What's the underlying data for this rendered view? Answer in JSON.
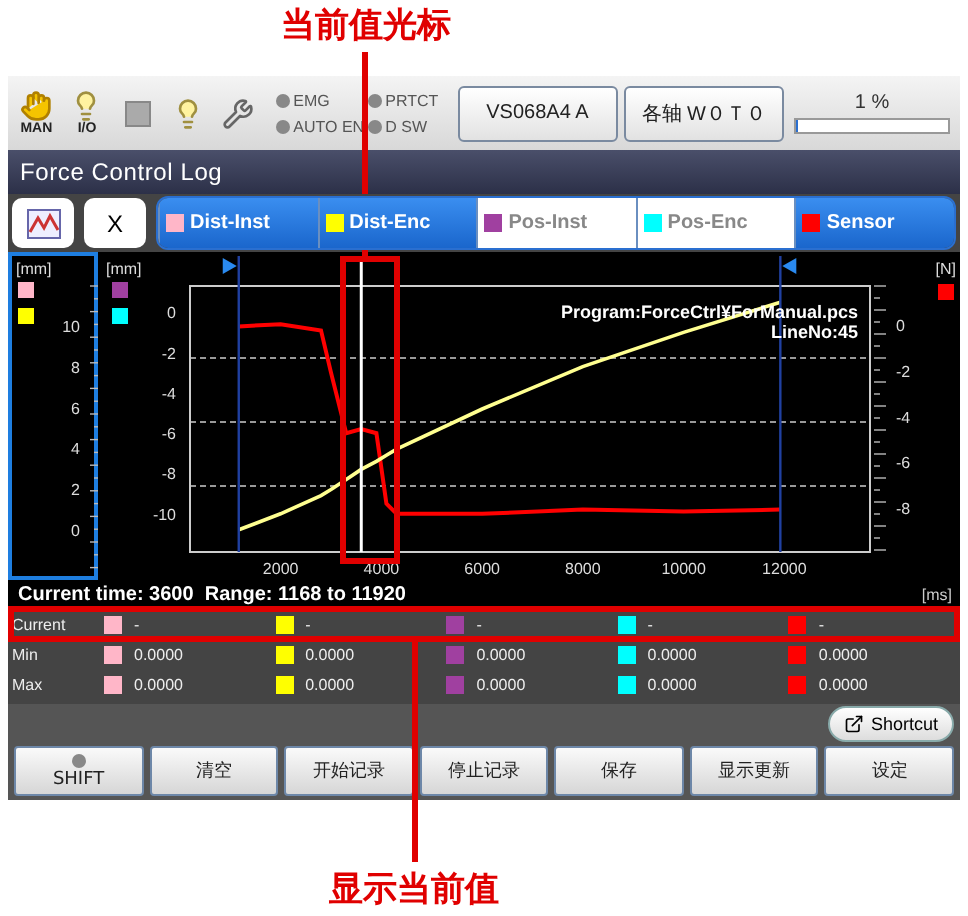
{
  "annotations": {
    "top": "当前值光标",
    "bottom": "显示当前值"
  },
  "status_bar": {
    "icons": [
      {
        "kind": "hand",
        "label": "MAN"
      },
      {
        "kind": "bulb",
        "label": "I/O"
      },
      {
        "kind": "square"
      },
      {
        "kind": "bulb"
      },
      {
        "kind": "wrench"
      }
    ],
    "indicators": [
      {
        "label": "EMG",
        "on": false
      },
      {
        "label": "AUTO EN",
        "on": false
      },
      {
        "label": "PRTCT",
        "on": false
      },
      {
        "label": "D SW",
        "on": false
      }
    ],
    "buttons": [
      "VS068A4 A",
      "各轴 W０Ｔ０"
    ],
    "speed": {
      "reading": "1 %",
      "level": 0.01
    }
  },
  "title": "Force Control Log",
  "toolbar": {
    "close_label": "X"
  },
  "legend": [
    {
      "label": "Dist-Inst",
      "color": "#ffb6c8",
      "selected": true
    },
    {
      "label": "Dist-Enc",
      "color": "#ffff00",
      "selected": true
    },
    {
      "label": "Pos-Inst",
      "color": "#a040a0",
      "selected": false
    },
    {
      "label": "Pos-Enc",
      "color": "#00ffff",
      "selected": false
    },
    {
      "label": "Sensor",
      "color": "#ff0000",
      "selected": true
    }
  ],
  "chart": {
    "left_axes": [
      {
        "unit": "[mm]",
        "ticks": [
          "10",
          "8",
          "6",
          "4",
          "2",
          "0"
        ]
      },
      {
        "unit": "[mm]"
      }
    ],
    "right_axis": {
      "unit": "[N]",
      "ticks": [
        "0",
        "-2",
        "-4",
        "-6",
        "-8"
      ]
    },
    "program": "Program:ForceCtrl¥ForManual.pcs",
    "line_no": "LineNo:45",
    "status_line": "Current time: 3600  Range: 1168 to 11920",
    "x_unit": "[ms]",
    "chart_data": {
      "type": "line",
      "x": [
        1168,
        2000,
        2800,
        3000,
        3300,
        3600,
        3900,
        4100,
        4300,
        6000,
        8000,
        10000,
        11920
      ],
      "series": [
        {
          "color": "#ff0000",
          "values": [
            -0.7,
            -0.6,
            -0.9,
            -3,
            -6,
            -5.8,
            -6,
            -9.5,
            -10,
            -10,
            -9.8,
            -9.9,
            -9.8
          ]
        },
        {
          "color": "#ffff90",
          "values": [
            -10.8,
            -10,
            -9.1,
            -8.8,
            -8.3,
            -7.8,
            -7.4,
            -7.1,
            -6.8,
            -4.8,
            -2.7,
            -1,
            0.5
          ]
        }
      ],
      "xlim": [
        200,
        13700
      ],
      "ylim": [
        -11.9,
        1.3
      ],
      "xticks": [
        2000,
        4000,
        6000,
        8000,
        10000,
        12000
      ],
      "yticks": [
        -10,
        -8,
        -6,
        -4,
        -2,
        0
      ],
      "ref_lines": [
        {
          "axis": "x",
          "value": 1168
        },
        {
          "axis": "x",
          "value": 11920
        },
        {
          "axis": "x",
          "value": 3600
        }
      ]
    }
  },
  "table": {
    "rows": [
      {
        "label": "Current",
        "values": [
          "-",
          "-",
          "-",
          "-",
          "-"
        ]
      },
      {
        "label": "Min",
        "values": [
          "0.0000",
          "0.0000",
          "0.0000",
          "0.0000",
          "0.0000"
        ]
      },
      {
        "label": "Max",
        "values": [
          "0.0000",
          "0.0000",
          "0.0000",
          "0.0000",
          "0.0000"
        ]
      }
    ]
  },
  "shortcut": "Shortcut",
  "buttons": [
    {
      "label": "SHIFT",
      "kind": "shift",
      "on": false
    },
    {
      "label": "清空",
      "kind": "plain"
    },
    {
      "label": "开始记录",
      "kind": "plain"
    },
    {
      "label": "停止记录",
      "kind": "plain"
    },
    {
      "label": "保存",
      "kind": "plain"
    },
    {
      "label": "显示更新",
      "kind": "plain"
    },
    {
      "label": "设定",
      "kind": "plain"
    }
  ]
}
